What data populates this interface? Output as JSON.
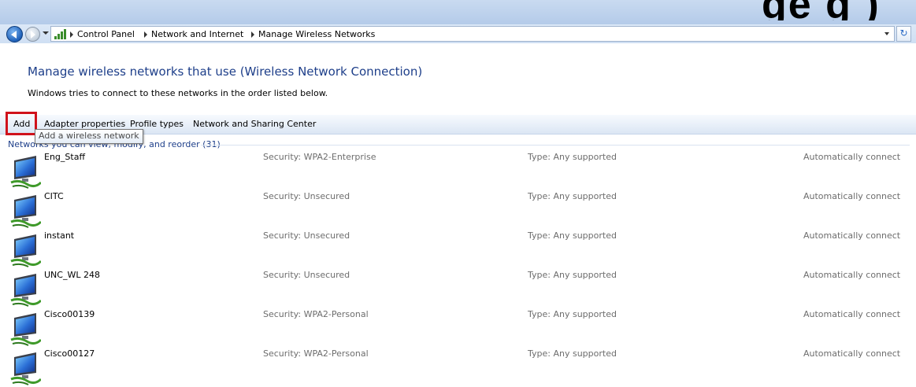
{
  "corner_logo_text": "ge g )",
  "address_bar": {
    "breadcrumbs": [
      "Control Panel",
      "Network and Internet",
      "Manage Wireless Networks"
    ]
  },
  "header": {
    "title": "Manage wireless networks that use (Wireless Network Connection)",
    "subtitle": "Windows tries to connect to these networks in the order listed below."
  },
  "toolbar": {
    "add_label": "Add",
    "adapter_properties_label": "Adapter properties",
    "profile_types_label": "Profile types",
    "network_sharing_label": "Network and Sharing Center",
    "add_tooltip": "Add a wireless network"
  },
  "group": {
    "header": "Networks you can view, modify, and reorder (31)"
  },
  "networks": [
    {
      "name": "Eng_Staff",
      "security": "Security: WPA2-Enterprise",
      "type": "Type: Any supported",
      "mode": "Automatically connect"
    },
    {
      "name": "CITC",
      "security": "Security: Unsecured",
      "type": "Type: Any supported",
      "mode": "Automatically connect"
    },
    {
      "name": "instant",
      "security": "Security: Unsecured",
      "type": "Type: Any supported",
      "mode": "Automatically connect"
    },
    {
      "name": "UNC_WL 248",
      "security": "Security: Unsecured",
      "type": "Type: Any supported",
      "mode": "Automatically connect"
    },
    {
      "name": "Cisco00139",
      "security": "Security: WPA2-Personal",
      "type": "Type: Any supported",
      "mode": "Automatically connect"
    },
    {
      "name": "Cisco00127",
      "security": "Security: WPA2-Personal",
      "type": "Type: Any supported",
      "mode": "Automatically connect"
    }
  ],
  "icons": {
    "back": "back-arrow-icon",
    "forward": "forward-arrow-icon",
    "network": "network-icon",
    "wireless_profile": "wireless-monitor-icon",
    "refresh": "refresh-icon"
  },
  "colors": {
    "title_blue": "#1e3f8a",
    "highlight_red": "#d0121b",
    "muted_text": "#6d6d6d"
  }
}
